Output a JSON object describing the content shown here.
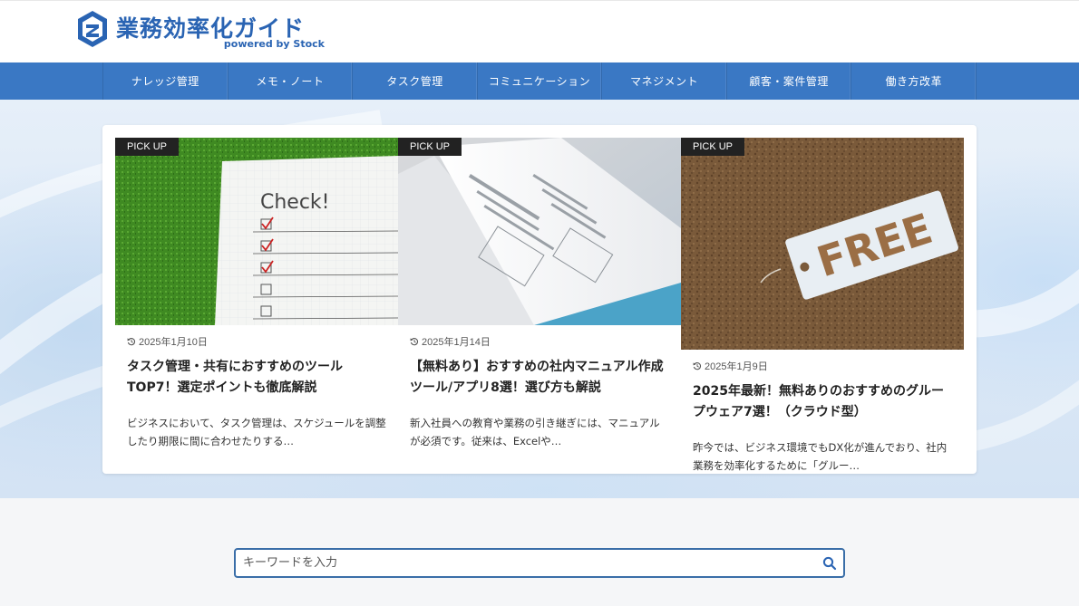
{
  "header": {
    "logo_title": "業務効率化ガイド",
    "logo_sub": "powered by Stock",
    "brand_color": "#2a64b3"
  },
  "nav": {
    "items": [
      {
        "label": "ナレッジ管理"
      },
      {
        "label": "メモ・ノート"
      },
      {
        "label": "タスク管理"
      },
      {
        "label": "コミュニケーション"
      },
      {
        "label": "マネジメント"
      },
      {
        "label": "顧客・案件管理"
      },
      {
        "label": "働き方改革"
      }
    ],
    "bg_color": "#3a78c4"
  },
  "pickup": {
    "cards": [
      {
        "badge": "PICK UP",
        "image_icon": "checklist-notebook-image",
        "date": "2025年1月10日",
        "title": "タスク管理・共有におすすめのツールTOP7！選定ポイントも徹底解説",
        "excerpt": "ビジネスにおいて、タスク管理は、スケジュールを調整したり期限に間に合わせたりする…"
      },
      {
        "badge": "PICK UP",
        "image_icon": "manual-document-image",
        "date": "2025年1月14日",
        "title": "【無料あり】おすすめの社内マニュアル作成ツール/アプリ8選！選び方も解説",
        "excerpt": "新入社員への教育や業務の引き継ぎには、マニュアルが必須です。従来は、Excelや…"
      },
      {
        "badge": "PICK UP",
        "image_icon": "free-tag-corkboard-image",
        "date": "2025年1月9日",
        "title": "2025年最新！無料ありのおすすめのグループウェア7選！（クラウド型）",
        "excerpt": "昨今では、ビジネス環境でもDX化が進んでおり、社内業務を効率化するために「グルー…"
      }
    ]
  },
  "search": {
    "placeholder": "キーワードを入力",
    "border_color": "#3a6ea8"
  }
}
